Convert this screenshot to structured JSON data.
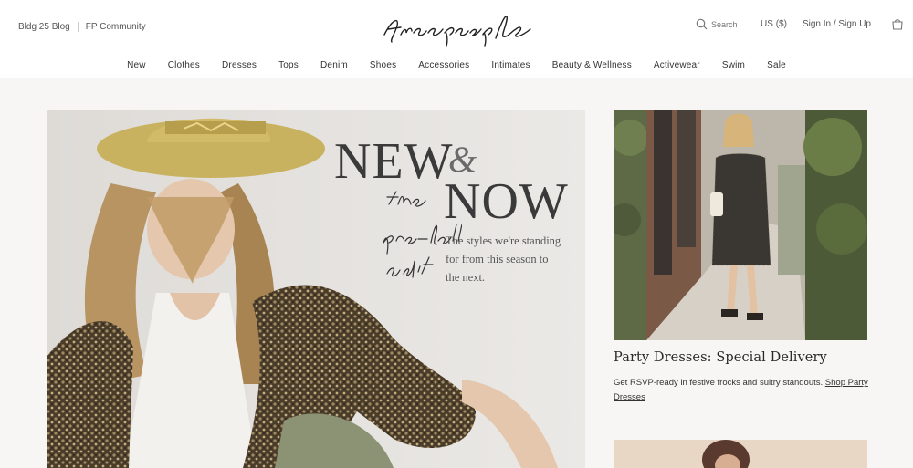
{
  "header": {
    "utility_links": [
      "Bldg 25 Blog",
      "FP Community"
    ],
    "logo_text": "free people",
    "search_placeholder": "Search",
    "currency": "US ($)",
    "signin": "Sign In / Sign Up"
  },
  "nav": {
    "items": [
      "New",
      "Clothes",
      "Dresses",
      "Tops",
      "Denim",
      "Shoes",
      "Accessories",
      "Intimates",
      "Beauty & Wellness",
      "Activewear",
      "Swim",
      "Sale"
    ]
  },
  "hero": {
    "line1": "NEW",
    "amp": "&",
    "line2": "NOW",
    "script": "the pre-fall edit",
    "copy": "The styles we're standing for from this season to the next."
  },
  "card": {
    "title": "Party Dresses: Special Delivery",
    "desc": "Get RSVP-ready in festive frocks and sultry standouts.",
    "link": "Shop Party Dresses"
  },
  "colors": {
    "background": "#f7f6f4",
    "text": "#333333",
    "hat": "#c9b25f",
    "sequin_jacket": "#5a4a33"
  }
}
